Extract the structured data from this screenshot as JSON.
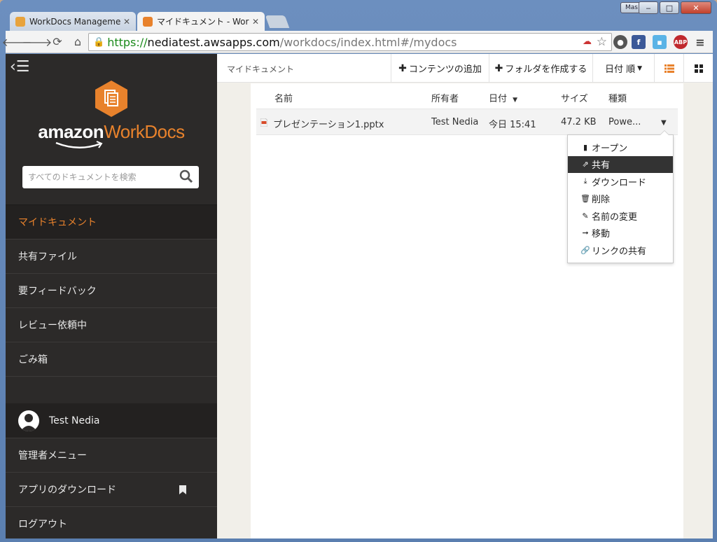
{
  "browser": {
    "tabs": [
      {
        "title": "WorkDocs Managemen",
        "active": false
      },
      {
        "title": "マイドキュメント - Work",
        "active": true
      }
    ],
    "user_chip": "Mas",
    "url": {
      "scheme": "https://",
      "host": "nediatest.awsapps.com",
      "path": "/workdocs/index.html#/mydocs"
    },
    "window_controls": {
      "minimize": "‒",
      "maximize": "□",
      "close": "✕"
    }
  },
  "sidebar": {
    "logo": {
      "amazon": "amazon",
      "workdocs": "WorkDocs"
    },
    "search_placeholder": "すべてのドキュメントを検索",
    "nav": [
      {
        "label": "マイドキュメント",
        "active": true
      },
      {
        "label": "共有ファイル",
        "active": false
      },
      {
        "label": "要フィードバック",
        "active": false
      },
      {
        "label": "レビュー依頼中",
        "active": false
      },
      {
        "label": "ごみ箱",
        "active": false
      }
    ],
    "user_name": "Test Nedia",
    "bottom": [
      {
        "label": "管理者メニュー"
      },
      {
        "label": "アプリのダウンロード"
      },
      {
        "label": "ログアウト"
      }
    ]
  },
  "topbar": {
    "breadcrumb": "マイドキュメント",
    "add_content": "コンテンツの追加",
    "create_folder": "フォルダを作成する",
    "sort": "日付 順"
  },
  "table": {
    "headers": {
      "name": "名前",
      "owner": "所有者",
      "date": "日付",
      "size": "サイズ",
      "type": "種類"
    },
    "rows": [
      {
        "name": "プレゼンテーション1.pptx",
        "owner": "Test Nedia",
        "date": "今日 15:41",
        "size": "47.2 KB",
        "type": "Powe..."
      }
    ]
  },
  "context_menu": [
    {
      "label": "オープン",
      "icon": "file-icon"
    },
    {
      "label": "共有",
      "icon": "share-icon",
      "highlighted": true
    },
    {
      "label": "ダウンロード",
      "icon": "download-icon"
    },
    {
      "label": "削除",
      "icon": "trash-icon"
    },
    {
      "label": "名前の変更",
      "icon": "pencil-icon"
    },
    {
      "label": "移動",
      "icon": "arrow-right-icon"
    },
    {
      "label": "リンクの共有",
      "icon": "link-icon"
    }
  ],
  "colors": {
    "accent": "#e8822c",
    "sidebar_bg": "#2c2a29",
    "list_view_active": "#e8822c"
  }
}
